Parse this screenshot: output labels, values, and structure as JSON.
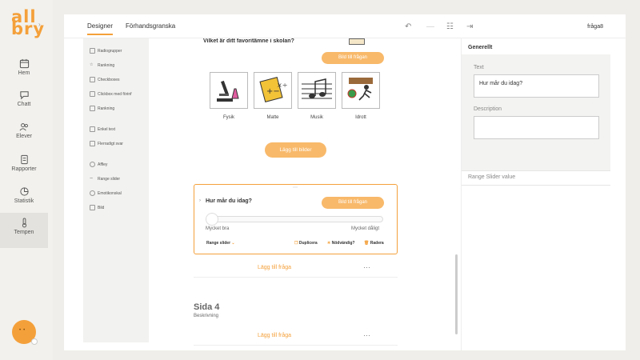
{
  "app": {
    "logo": "all\nbry"
  },
  "nav": [
    {
      "label": "Hem",
      "icon": "calendar-icon"
    },
    {
      "label": "Chatt",
      "icon": "chat-icon"
    },
    {
      "label": "Elever",
      "icon": "students-icon"
    },
    {
      "label": "Rapporter",
      "icon": "report-icon"
    },
    {
      "label": "Statistik",
      "icon": "pie-chart-icon"
    },
    {
      "label": "Tempen",
      "icon": "thermometer-icon"
    }
  ],
  "topbar": {
    "tabs": [
      "Designer",
      "Förhandsgranska"
    ],
    "form_name": "fråga8"
  },
  "toolbox": [
    "Radiogrupper",
    "Rankning",
    "Checkboxes",
    "Clickbox med förinf",
    "Rankning",
    "Enkel text",
    "Flerradigt svar",
    "Affley",
    "Range slider",
    "Emotikonskal",
    "Bild"
  ],
  "canvas": {
    "q1_title": "Vilket är ditt favoritämne i skolan?",
    "add_image_label": "Bild till frågan",
    "images": [
      "Fysik",
      "Matte",
      "Musik",
      "Idrott"
    ],
    "add_images_label": "Lägg till bilder",
    "q2_title": "Hur mår du idag?",
    "q2_add_image": "Bild till frågan",
    "slider_min": "Mycket bra",
    "slider_max": "Mycket dåligt",
    "question_type": "Range slider",
    "actions": {
      "duplicate": "Duplicera",
      "required": "Nödvändig?",
      "delete": "Radera"
    },
    "add_question": "Lägg till fråga",
    "page4_title": "Sida 4",
    "page4_desc": "Beskrivning",
    "add_question_2": "Lägg till fråga"
  },
  "props": {
    "header": "Generellt",
    "text_label": "Text",
    "text_value": "Hur mår du idag?",
    "desc_label": "Description",
    "desc_value": "",
    "range_label": "Range Slider value"
  },
  "colors": {
    "accent": "#f4a03a"
  }
}
